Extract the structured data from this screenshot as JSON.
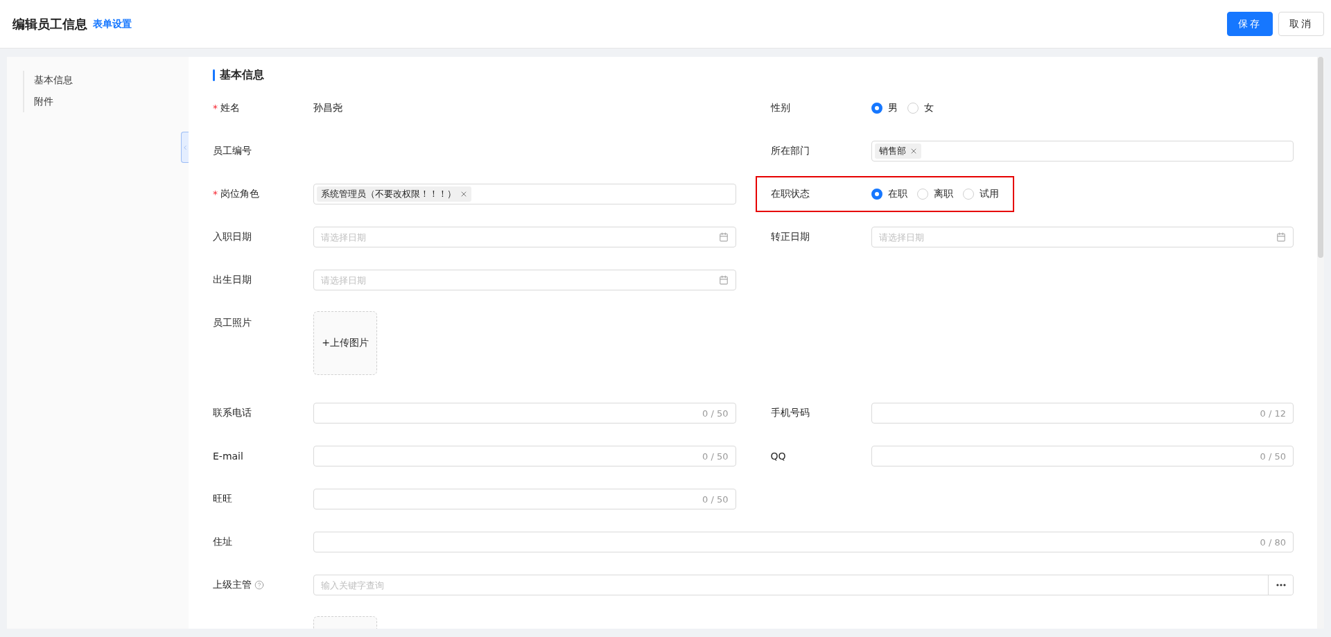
{
  "header": {
    "title": "编辑员工信息",
    "link": "表单设置",
    "buttons": [
      {
        "label": "保存",
        "kind": "primary"
      },
      {
        "label": "取消",
        "kind": "default"
      }
    ]
  },
  "sidebar": {
    "items": [
      {
        "label": "基本信息"
      },
      {
        "label": "附件"
      }
    ]
  },
  "section": {
    "title": "基本信息"
  },
  "rows": [
    {
      "cells": [
        {
          "kind": "static",
          "label": "姓名",
          "required_mark": "*",
          "value": "孙昌尧"
        },
        {
          "kind": "radio",
          "label": "性别",
          "options": [
            {
              "label": "男",
              "selected": true
            },
            {
              "label": "女",
              "selected": false
            }
          ]
        }
      ]
    },
    {
      "cells": [
        {
          "kind": "static",
          "label": "员工编号"
        },
        {
          "kind": "tags",
          "label": "所在部门",
          "tags": [
            "销售部"
          ]
        }
      ]
    },
    {
      "cells": [
        {
          "kind": "tags",
          "label": "岗位角色",
          "required_mark": "*",
          "tags": [
            "系统管理员（不要改权限！！！）"
          ]
        },
        {
          "kind": "radio",
          "label": "在职状态",
          "highlighted": true,
          "options": [
            {
              "label": "在职",
              "selected": true
            },
            {
              "label": "离职",
              "selected": false
            },
            {
              "label": "试用",
              "selected": false
            }
          ]
        }
      ]
    },
    {
      "cells": [
        {
          "kind": "date",
          "label": "入职日期",
          "placeholder": "请选择日期"
        },
        {
          "kind": "date",
          "label": "转正日期",
          "placeholder": "请选择日期"
        }
      ]
    },
    {
      "cells": [
        {
          "kind": "date",
          "label": "出生日期",
          "placeholder": "请选择日期"
        }
      ]
    },
    {
      "cells": [
        {
          "kind": "upload",
          "label": "员工照片",
          "button": "+上传图片"
        }
      ]
    },
    {
      "cells": [
        {
          "kind": "counter",
          "label": "联系电话",
          "counter": "0 / 50"
        },
        {
          "kind": "counter",
          "label": "手机号码",
          "counter": "0 / 12"
        }
      ]
    },
    {
      "cells": [
        {
          "kind": "counter",
          "label": "E-mail",
          "counter": "0 / 50"
        },
        {
          "kind": "counter",
          "label": "QQ",
          "counter": "0 / 50"
        }
      ]
    },
    {
      "cells": [
        {
          "kind": "counter",
          "label": "旺旺",
          "counter": "0 / 50"
        }
      ]
    },
    {
      "wide": true,
      "cells": [
        {
          "kind": "counter",
          "label": "住址",
          "counter": "0 / 80"
        }
      ]
    },
    {
      "wide": true,
      "cells": [
        {
          "kind": "search",
          "label": "上级主管",
          "help": true,
          "placeholder": "输入关键字查询"
        }
      ]
    },
    {
      "cells": [
        {
          "kind": "upload"
        }
      ]
    }
  ]
}
